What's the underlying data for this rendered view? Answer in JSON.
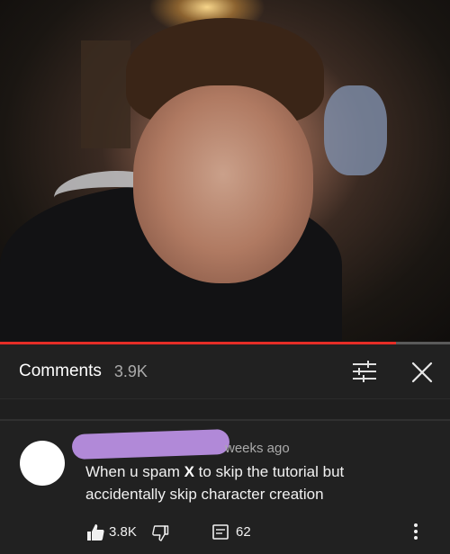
{
  "video": {
    "progress_fraction": 0.88,
    "colors": {
      "played": "#e52d27",
      "buffer": "#5a5a5a"
    }
  },
  "comments_panel": {
    "title": "Comments",
    "count": "3.9K",
    "icons": {
      "filter": "sort-filter-icon",
      "close": "close-icon"
    }
  },
  "comment": {
    "time": "weeks ago",
    "text_before": "When u spam ",
    "text_bold": "X",
    "text_after": " to skip the tutorial but accidentally skip character creation",
    "likes": "3.8K",
    "replies": "62",
    "icons": {
      "like": "thumbs-up-icon",
      "dislike": "thumbs-down-icon",
      "reply": "reply-icon",
      "more": "more-vertical-icon"
    }
  }
}
